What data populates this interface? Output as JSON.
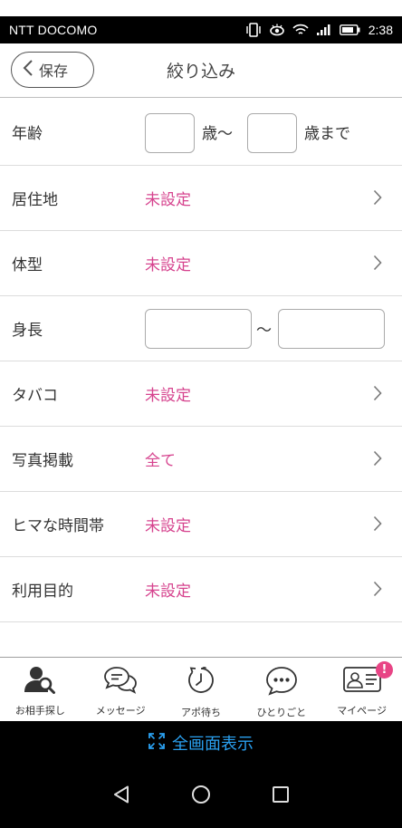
{
  "status_bar": {
    "carrier": "NTT DOCOMO",
    "time": "2:38"
  },
  "header": {
    "back_label": "保存",
    "title": "絞り込み"
  },
  "filters": {
    "age": {
      "label": "年齢",
      "from_suffix": "歳〜",
      "to_suffix": "歳まで",
      "from_value": "",
      "to_value": ""
    },
    "residence": {
      "label": "居住地",
      "value": "未設定"
    },
    "body_type": {
      "label": "体型",
      "value": "未設定"
    },
    "height": {
      "label": "身長",
      "separator": "〜",
      "from_value": "",
      "to_value": ""
    },
    "tobacco": {
      "label": "タバコ",
      "value": "未設定"
    },
    "photo": {
      "label": "写真掲載",
      "value": "全て"
    },
    "free_time": {
      "label": "ヒマな時間帯",
      "value": "未設定"
    },
    "purpose": {
      "label": "利用目的",
      "value": "未設定"
    }
  },
  "tabs": [
    {
      "label": "お相手探し",
      "icon": "person-search-icon"
    },
    {
      "label": "メッセージ",
      "icon": "chat-bubbles-icon"
    },
    {
      "label": "アポ待ち",
      "icon": "clock-icon"
    },
    {
      "label": "ひとりごと",
      "icon": "speech-bubble-icon"
    },
    {
      "label": "マイページ",
      "icon": "profile-card-icon",
      "badge": "!"
    }
  ],
  "fullscreen": {
    "label": "全画面表示"
  },
  "colors": {
    "accent": "#d6438e",
    "badge": "#e84485",
    "fullscreen_text": "#2aa0f0"
  }
}
